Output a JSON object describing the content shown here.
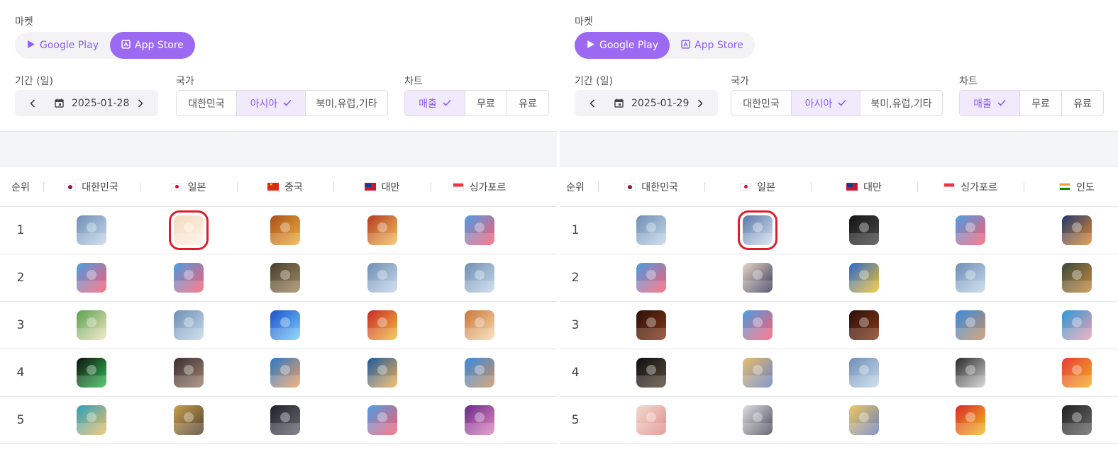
{
  "panels": [
    {
      "market_label": "마켓",
      "market": {
        "google_label": "Google Play",
        "apple_label": "App Store",
        "active": "apple"
      },
      "period_label": "기간 (일)",
      "date": "2025-01-28",
      "country_label": "국가",
      "regions": [
        {
          "label": "대한민국",
          "selected": false
        },
        {
          "label": "아시아",
          "selected": true
        },
        {
          "label": "북미,유럽,기타",
          "selected": false
        }
      ],
      "chart_label": "차트",
      "charts": [
        {
          "label": "매출",
          "selected": true
        },
        {
          "label": "무료",
          "selected": false
        },
        {
          "label": "유료",
          "selected": false
        }
      ],
      "columns": [
        {
          "label": "순위"
        },
        {
          "label": "대한민국",
          "flag": "kr"
        },
        {
          "label": "일본",
          "flag": "jp"
        },
        {
          "label": "중국",
          "flag": "cn"
        },
        {
          "label": "대만",
          "flag": "tw"
        },
        {
          "label": "싱가포르",
          "flag": "sg"
        }
      ],
      "rows": [
        {
          "rank": "1",
          "apps": [
            {
              "icon": "snow-battle-game-icon",
              "colors": [
                "#6f8fb5",
                "#c6d8ea"
              ]
            },
            {
              "icon": "anime-blonde-girl-game-icon",
              "colors": [
                "#f3d9c0",
                "#fff4e8"
              ],
              "highlighted": true
            },
            {
              "icon": "honor-of-kings-icon",
              "colors": [
                "#a8501a",
                "#f0b040"
              ]
            },
            {
              "icon": "warrior-game-icon",
              "colors": [
                "#b43c1e",
                "#f2c060"
              ]
            },
            {
              "icon": "runner-x2-game-icon",
              "colors": [
                "#4aa0e6",
                "#ff5a6e"
              ]
            }
          ]
        },
        {
          "rank": "2",
          "apps": [
            {
              "icon": "runner-x2-game-icon",
              "colors": [
                "#4aa0e6",
                "#ff5a6e"
              ]
            },
            {
              "icon": "runner-x2-game-icon",
              "colors": [
                "#4aa0e6",
                "#ff5a6e"
              ]
            },
            {
              "icon": "pubg-mobile-icon",
              "colors": [
                "#4a4030",
                "#a08a60"
              ]
            },
            {
              "icon": "snow-battle-game-icon",
              "colors": [
                "#6f8fb5",
                "#c6d8ea"
              ]
            },
            {
              "icon": "snow-battle-game-icon",
              "colors": [
                "#6f8fb5",
                "#c6d8ea"
              ]
            }
          ]
        },
        {
          "rank": "3",
          "apps": [
            {
              "icon": "penguin-soccer-game-icon",
              "colors": [
                "#5aa050",
                "#f2e6c0"
              ]
            },
            {
              "icon": "snow-battle-game-icon",
              "colors": [
                "#6f8fb5",
                "#c6d8ea"
              ]
            },
            {
              "icon": "blue-penguin-game-icon",
              "colors": [
                "#1e50c8",
                "#7ad0ff"
              ]
            },
            {
              "icon": "red-casino-game-icon",
              "colors": [
                "#c82828",
                "#f2c040"
              ]
            },
            {
              "icon": "cat-character-game-icon",
              "colors": [
                "#c8763c",
                "#f8dcb0"
              ]
            }
          ]
        },
        {
          "rank": "4",
          "apps": [
            {
              "icon": "fc-football-icon",
              "colors": [
                "#101010",
                "#30c050"
              ]
            },
            {
              "icon": "konami-baseball-icon",
              "colors": [
                "#3a3030",
                "#a08070"
              ]
            },
            {
              "icon": "league-wildrift-icon",
              "colors": [
                "#2878c8",
                "#f2a060"
              ]
            },
            {
              "icon": "league-wildrift-icon",
              "colors": [
                "#1a5aa0",
                "#f2b050"
              ]
            },
            {
              "icon": "capybara-game-icon",
              "colors": [
                "#3c8ce0",
                "#c89060"
              ]
            }
          ]
        },
        {
          "rank": "5",
          "apps": [
            {
              "icon": "jinx-character-icon",
              "colors": [
                "#2aa0c0",
                "#f0c060"
              ]
            },
            {
              "icon": "soldier-game-icon",
              "colors": [
                "#c8a050",
                "#504030"
              ]
            },
            {
              "icon": "crossfire-soldier-icon",
              "colors": [
                "#202028",
                "#6a6a78"
              ]
            },
            {
              "icon": "runner-x2-game-icon",
              "colors": [
                "#4aa0e6",
                "#ff5a6e"
              ]
            },
            {
              "icon": "woman-portrait-game-icon",
              "colors": [
                "#6a2a8a",
                "#e08ac0"
              ]
            }
          ]
        }
      ]
    },
    {
      "market_label": "마켓",
      "market": {
        "google_label": "Google Play",
        "apple_label": "App Store",
        "active": "google"
      },
      "period_label": "기간 (일)",
      "date": "2025-01-29",
      "country_label": "국가",
      "regions": [
        {
          "label": "대한민국",
          "selected": false
        },
        {
          "label": "아시아",
          "selected": true
        },
        {
          "label": "북미,유럽,기타",
          "selected": false
        }
      ],
      "chart_label": "차트",
      "charts": [
        {
          "label": "매출",
          "selected": true
        },
        {
          "label": "무료",
          "selected": false
        },
        {
          "label": "유료",
          "selected": false
        }
      ],
      "columns": [
        {
          "label": "순위"
        },
        {
          "label": "대한민국",
          "flag": "kr"
        },
        {
          "label": "일본",
          "flag": "jp"
        },
        {
          "label": "대만",
          "flag": "tw"
        },
        {
          "label": "싱가포르",
          "flag": "sg"
        },
        {
          "label": "인도",
          "flag": "in"
        }
      ],
      "rows": [
        {
          "rank": "1",
          "apps": [
            {
              "icon": "snow-battle-game-icon",
              "colors": [
                "#6f8fb5",
                "#c6d8ea"
              ]
            },
            {
              "icon": "silver-hair-anime-icon",
              "colors": [
                "#5a78a8",
                "#d8e0f0"
              ],
              "highlighted": true
            },
            {
              "icon": "lineage-w-icon",
              "colors": [
                "#141414",
                "#4a4a4a"
              ]
            },
            {
              "icon": "runner-x2-game-icon",
              "colors": [
                "#4aa0e6",
                "#ff5a6e"
              ]
            },
            {
              "icon": "free-fire-icon",
              "colors": [
                "#203a70",
                "#e08a30"
              ]
            }
          ]
        },
        {
          "rank": "2",
          "apps": [
            {
              "icon": "runner-x2-game-icon",
              "colors": [
                "#4aa0e6",
                "#ff5a6e"
              ]
            },
            {
              "icon": "anime-girl-game-icon",
              "colors": [
                "#e8d8c8",
                "#3a3a5a"
              ]
            },
            {
              "icon": "casino-slot-game-icon",
              "colors": [
                "#2a6ad8",
                "#f2c020"
              ]
            },
            {
              "icon": "snow-battle-game-icon",
              "colors": [
                "#6f8fb5",
                "#c6d8ea"
              ]
            },
            {
              "icon": "pubg-mobile-icon",
              "colors": [
                "#3a4a3a",
                "#c88a40"
              ]
            }
          ]
        },
        {
          "rank": "3",
          "apps": [
            {
              "icon": "lineage-m-icon",
              "colors": [
                "#2a100a",
                "#8a3a1a"
              ]
            },
            {
              "icon": "runner-x2-game-icon",
              "colors": [
                "#4aa0e6",
                "#ff5a6e"
              ]
            },
            {
              "icon": "lineage-m-icon",
              "colors": [
                "#2a100a",
                "#8a3a1a"
              ]
            },
            {
              "icon": "capybara-game-icon",
              "colors": [
                "#3c8ce0",
                "#c89060"
              ]
            },
            {
              "icon": "pig-game-icon",
              "colors": [
                "#2a9ad8",
                "#f0a0b0"
              ]
            }
          ]
        },
        {
          "rank": "4",
          "apps": [
            {
              "icon": "odin-game-icon",
              "colors": [
                "#101010",
                "#5a4a3a"
              ]
            },
            {
              "icon": "fate-anime-icon",
              "colors": [
                "#e8c070",
                "#6a80c0"
              ]
            },
            {
              "icon": "snow-battle-game-icon",
              "colors": [
                "#6f8fb5",
                "#c6d8ea"
              ]
            },
            {
              "icon": "roblox-icon",
              "colors": [
                "#2a2a2a",
                "#cfcfcf"
              ]
            },
            {
              "icon": "candy-crush-icon",
              "colors": [
                "#e83a3a",
                "#f2b020"
              ]
            }
          ]
        },
        {
          "rank": "5",
          "apps": [
            {
              "icon": "blonde-anime-girl-icon",
              "colors": [
                "#f2dcd0",
                "#e08a8a"
              ]
            },
            {
              "icon": "white-hair-anime-icon",
              "colors": [
                "#e0e0e6",
                "#4a4a5a"
              ]
            },
            {
              "icon": "fate-anime-icon",
              "colors": [
                "#f0c860",
                "#6a80c0"
              ]
            },
            {
              "icon": "monopoly-go-icon",
              "colors": [
                "#d82a2a",
                "#f2c020"
              ]
            },
            {
              "icon": "call-of-duty-icon",
              "colors": [
                "#202020",
                "#6a6a6a"
              ]
            }
          ]
        }
      ]
    }
  ]
}
